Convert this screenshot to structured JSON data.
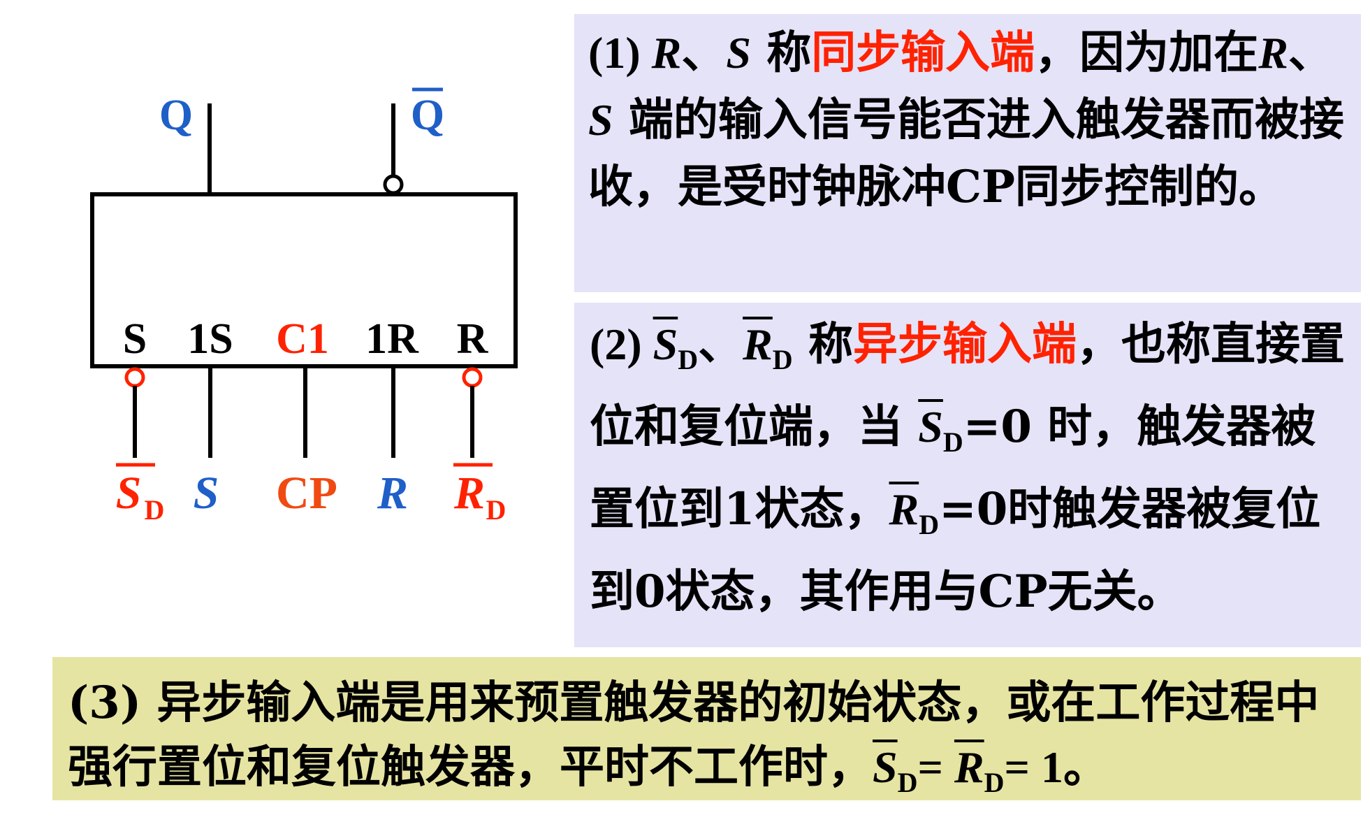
{
  "colors": {
    "blue": "#1f5fc8",
    "red": "#ff2200",
    "orange": "#f04a12",
    "panel": "#e4e3f8",
    "note": "#e6e4a2"
  },
  "symbol": {
    "q": "Q",
    "q_bar": "Q",
    "inner_labels": [
      "S",
      "1S",
      "C1",
      "1R",
      "R"
    ],
    "sd_main": "S",
    "sd_sub": "D",
    "s": "S",
    "cp": "CP",
    "r": "R",
    "rd_main": "R",
    "rd_sub": "D"
  },
  "box1": {
    "num": "(1) ",
    "r": "R",
    "sep": "、",
    "s": "S",
    "t1": " 称",
    "hl": "同步输入端",
    "t2": "，因为加在",
    "r2": "R",
    "sep2": "、",
    "s2": "S",
    "t3": " 端的输入信号能否进入触发器而被接收，是受时钟脉冲CP同步控制的。"
  },
  "box2": {
    "num": "(2) ",
    "sd": "S",
    "d": "D",
    "sep": "、",
    "rd": "R",
    "d2": "D",
    "t1": " 称",
    "hl": "异步输入端",
    "t2": "，也称直接置位和复位端，当 ",
    "sd2": "S",
    "d3": "D",
    "t3": "=0 时，触发器被置位到1状态，",
    "rd2": "R",
    "d4": "D",
    "t4": "=0时触发器被复位到0状态，其作用与CP无关。"
  },
  "box3": {
    "t1": "(3) 异步输入端是用来预置触发器的初始状态，或在工作过程中强行置位和复位触发器，平时不工作时，",
    "sd": "S",
    "d": "D",
    "eq": "= ",
    "rd": "R",
    "d2": "D",
    "end": "= 1。"
  }
}
